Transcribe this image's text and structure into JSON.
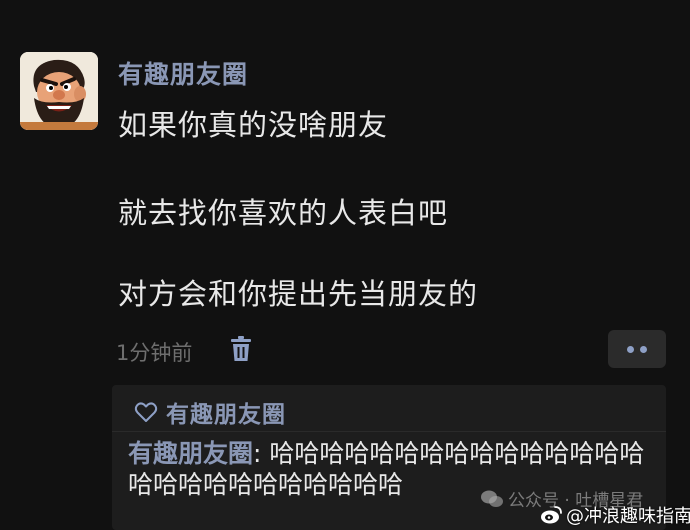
{
  "post": {
    "author": "有趣朋友圈",
    "avatar_icon": "cartoon-bearded-man-avatar",
    "lines": [
      "如果你真的没啥朋友",
      "就去找你喜欢的人表白吧",
      "对方会和你提出先当朋友的"
    ],
    "timestamp": "1分钟前",
    "delete_icon": "trash-icon",
    "more_icon": "more-dots-icon"
  },
  "interactions": {
    "like_icon": "heart-icon",
    "likes": "有趣朋友圈",
    "comments": [
      {
        "author": "有趣朋友圈",
        "separator": ": ",
        "text": "哈哈哈哈哈哈哈哈哈哈哈哈哈哈哈哈哈哈哈哈哈哈哈哈哈哈"
      }
    ]
  },
  "watermarks": {
    "account": "公众号 · 吐槽星君",
    "weibo": "@冲浪趣味指南"
  },
  "colors": {
    "background": "#111111",
    "name_accent": "#8a97b5",
    "text": "#e8e8e8",
    "muted": "#6e6e6e",
    "panel": "#1d1d1d"
  }
}
